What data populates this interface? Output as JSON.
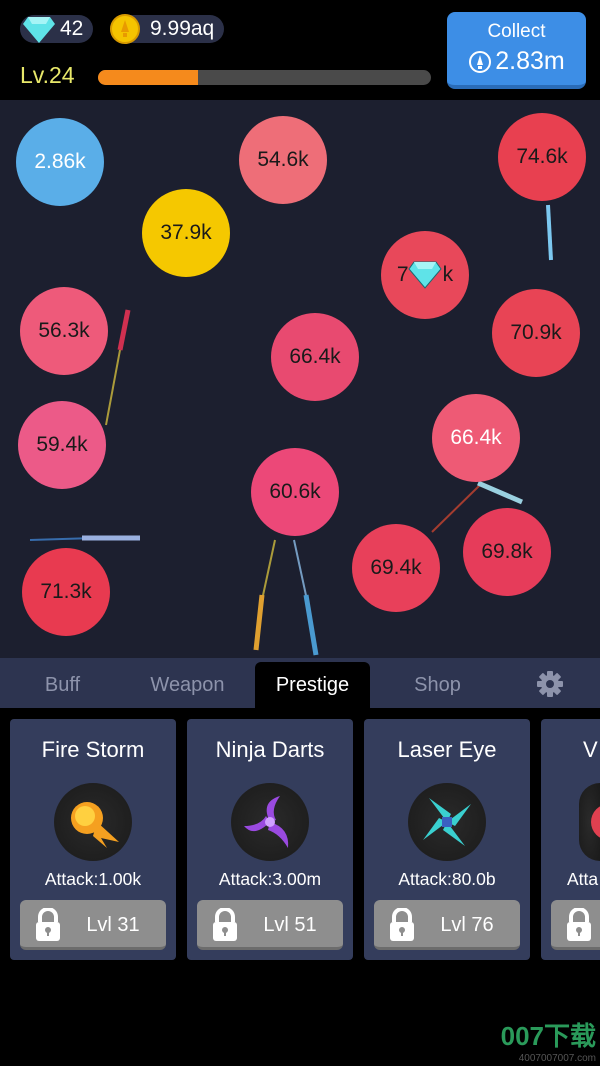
{
  "header": {
    "gems": "42",
    "coins": "9.99aq",
    "level": "Lv.24",
    "level_progress": 0.3,
    "collect": {
      "label": "Collect",
      "value": "2.83m"
    }
  },
  "bubbles": [
    {
      "text": "2.86k",
      "color": "#5aaee8"
    },
    {
      "text": "54.6k",
      "color": "#ee6e78"
    },
    {
      "text": "74.6k",
      "color": "#e84050"
    },
    {
      "text": "37.9k",
      "color": "#f5c800"
    },
    {
      "text_left": "7",
      "text_right": "k",
      "color": "#e8485a",
      "has_gem": true
    },
    {
      "text": "56.3k",
      "color": "#ee5a7a"
    },
    {
      "text": "70.9k",
      "color": "#e84455"
    },
    {
      "text": "66.4k",
      "color": "#e84a70"
    },
    {
      "text": "59.4k",
      "color": "#ec5a88"
    },
    {
      "text": "66.4k",
      "color": "#ee5a75"
    },
    {
      "text": "60.6k",
      "color": "#ec4878"
    },
    {
      "text": "69.8k",
      "color": "#e63c5a"
    },
    {
      "text": "69.4k",
      "color": "#e8405a"
    },
    {
      "text": "71.3k",
      "color": "#e83a50"
    }
  ],
  "tabs": [
    {
      "label": "Buff"
    },
    {
      "label": "Weapon"
    },
    {
      "label": "Prestige",
      "active": true
    },
    {
      "label": "Shop"
    }
  ],
  "cards": [
    {
      "name": "Fire Storm",
      "attack": "Attack:1.00k",
      "unlock": "Lvl 31",
      "icon": "fireball-icon"
    },
    {
      "name": "Ninja Darts",
      "attack": "Attack:3.00m",
      "unlock": "Lvl 51",
      "icon": "purple-shuriken-icon"
    },
    {
      "name": "Laser Eye",
      "attack": "Attack:80.0b",
      "unlock": "Lvl 76",
      "icon": "cyan-shuriken-icon"
    },
    {
      "name": "V",
      "attack": "Atta",
      "unlock": "",
      "icon": "red-weapon-icon"
    }
  ],
  "watermark": {
    "text": "007下载",
    "url": "4007007007.com"
  }
}
